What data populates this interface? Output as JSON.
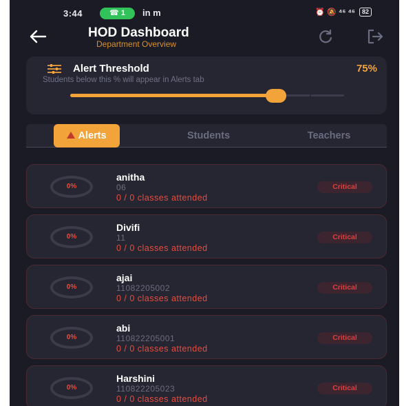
{
  "status_bar": {
    "time": "3:44",
    "pill_label": "1",
    "apps": "in m",
    "right": "⏰ 🔕 ⁴⁶ ⁴⁶",
    "battery": "82"
  },
  "header": {
    "title": "HOD Dashboard",
    "subtitle": "Department Overview",
    "back_icon": "arrow-left-icon",
    "refresh_icon": "refresh-icon",
    "logout_icon": "logout-icon"
  },
  "threshold": {
    "title": "Alert Threshold",
    "value": "75%",
    "value_fraction": 0.75,
    "description": "Students below this % will appear in Alerts tab"
  },
  "tabs": [
    {
      "label": "Alerts",
      "active": true
    },
    {
      "label": "Students",
      "active": false
    },
    {
      "label": "Teachers",
      "active": false
    }
  ],
  "students": [
    {
      "percent": "0%",
      "name": "anitha",
      "id": "06",
      "classes": "0 / 0 classes attended",
      "status": "Critical"
    },
    {
      "percent": "0%",
      "name": "Divifi",
      "id": "11",
      "classes": "0 / 0 classes attended",
      "status": "Critical"
    },
    {
      "percent": "0%",
      "name": "ajai",
      "id": "11082205002",
      "classes": "0 / 0 classes attended",
      "status": "Critical"
    },
    {
      "percent": "0%",
      "name": "abi",
      "id": "110822205001",
      "classes": "0 / 0 classes attended",
      "status": "Critical"
    },
    {
      "percent": "0%",
      "name": "Harshini",
      "id": "110822205023",
      "classes": "0 / 0 classes attended",
      "status": "Critical"
    }
  ],
  "colors": {
    "background": "#1b1b26",
    "card": "#262633",
    "accent": "#f2a33a",
    "critical": "#e74c3c"
  }
}
